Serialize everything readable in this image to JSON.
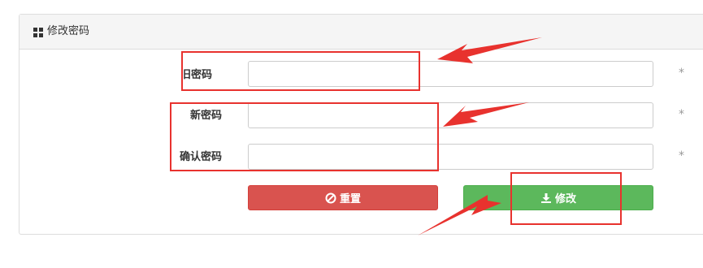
{
  "panel": {
    "title": "修改密码",
    "icon": "grid-icon"
  },
  "form": {
    "old_password": {
      "label": "旧密码",
      "value": "",
      "placeholder": ""
    },
    "new_password": {
      "label": "新密码",
      "value": "",
      "placeholder": ""
    },
    "confirm_password": {
      "label": "确认密码",
      "value": "",
      "placeholder": ""
    },
    "required_mark": "*"
  },
  "buttons": {
    "reset": {
      "label": "重置",
      "icon": "ban-icon",
      "color": "#d9534f"
    },
    "submit": {
      "label": "修改",
      "icon": "download-icon",
      "color": "#5cb85c"
    }
  },
  "annotation": {
    "color": "#e8322e"
  }
}
